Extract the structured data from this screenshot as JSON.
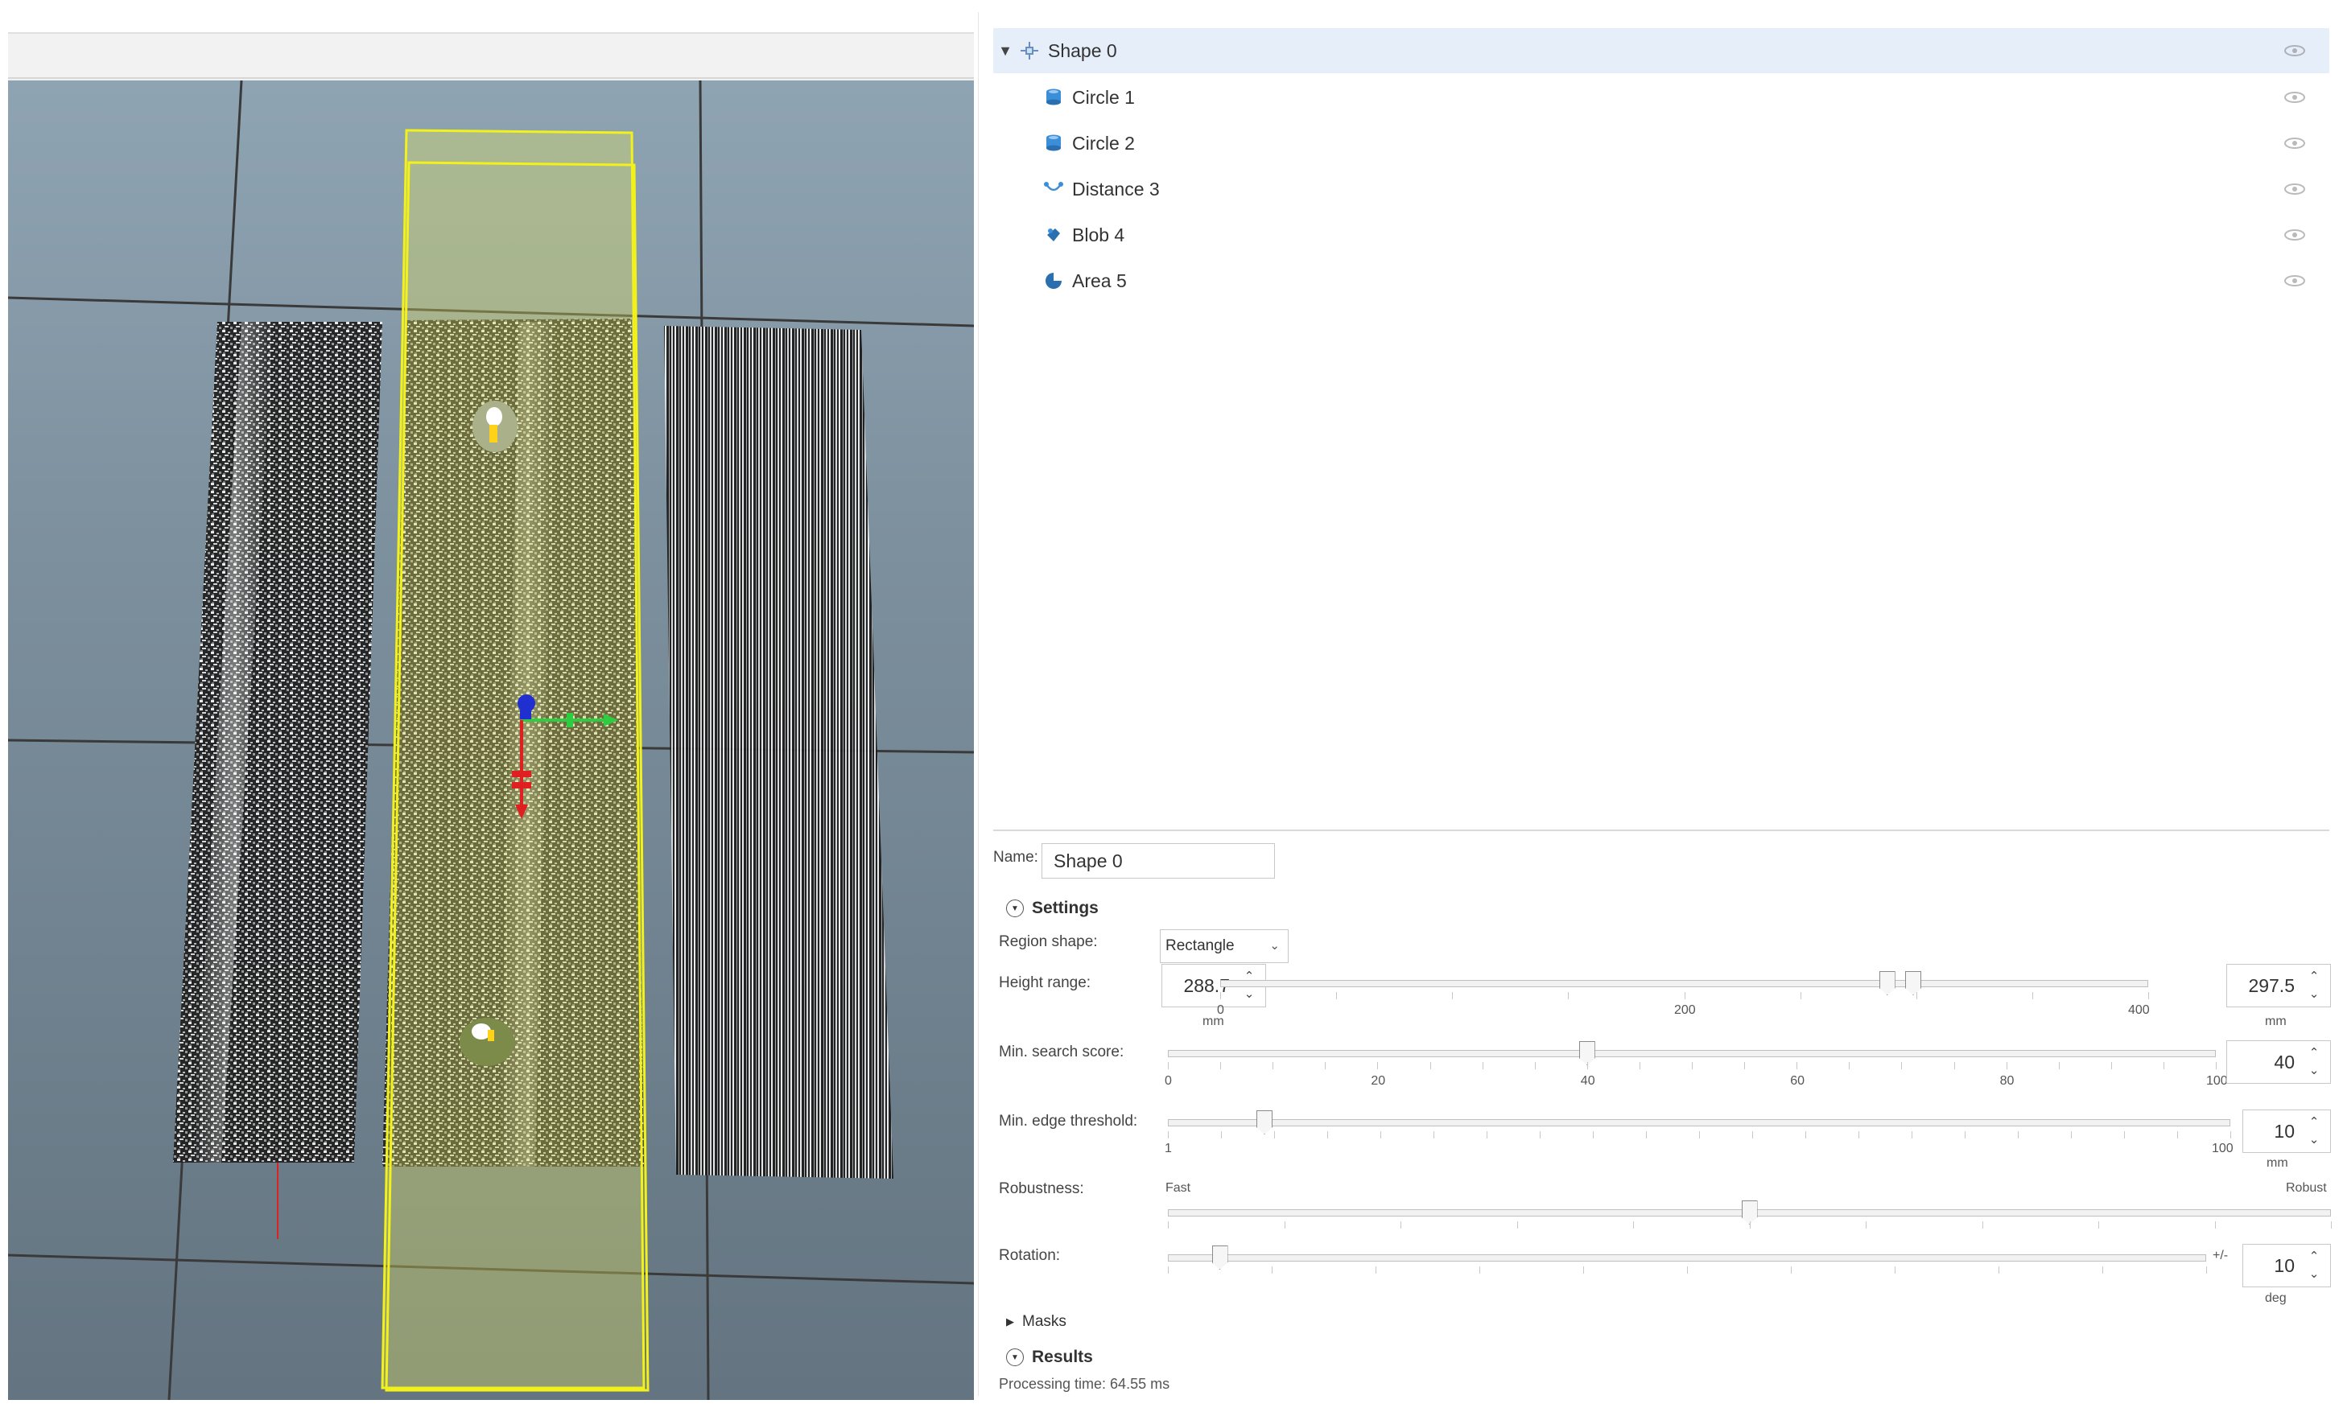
{
  "tree": {
    "items": [
      {
        "label": "Shape 0",
        "icon": "shape-move-icon",
        "selected": true,
        "expanded": true
      },
      {
        "label": "Circle 1",
        "icon": "cylinder-icon"
      },
      {
        "label": "Circle 2",
        "icon": "cylinder-icon"
      },
      {
        "label": "Distance 3",
        "icon": "distance-icon"
      },
      {
        "label": "Blob 4",
        "icon": "blob-icon"
      },
      {
        "label": "Area 5",
        "icon": "area-icon"
      }
    ]
  },
  "properties": {
    "name_label": "Name:",
    "name_value": "Shape 0",
    "settings_label": "Settings",
    "region_shape": {
      "label": "Region shape:",
      "value": "Rectangle"
    },
    "height_range": {
      "label": "Height range:",
      "min_value": "288.7",
      "max_value": "297.5",
      "min_unit": "mm",
      "max_unit": "mm",
      "scale_min": "0",
      "scale_mid": "200",
      "scale_max": "400",
      "range_start": 288.7,
      "range_end": 297.5,
      "range_limits": [
        0,
        400
      ]
    },
    "min_search_score": {
      "label": "Min. search score:",
      "value": "40",
      "ticks": [
        "0",
        "20",
        "40",
        "60",
        "80",
        "100"
      ],
      "level": 40,
      "limits": [
        0,
        100
      ]
    },
    "min_edge_threshold": {
      "label": "Min. edge threshold:",
      "value": "10",
      "unit": "mm",
      "scale_min": "1",
      "scale_max": "100",
      "level": 10,
      "limits": [
        1,
        100
      ]
    },
    "robustness": {
      "label": "Robustness:",
      "low_label": "Fast",
      "high_label": "Robust",
      "level": 0.5
    },
    "rotation": {
      "label": "Rotation:",
      "plus_minus": "+/-",
      "value": "10",
      "unit": "deg",
      "level": 0.05
    },
    "masks_label": "Masks",
    "results_label": "Results",
    "processing_time": "Processing time: 64.55 ms"
  },
  "colors": {
    "selection": "#e5eef9",
    "region_box": "#f2f21a",
    "axis_x": "#2ecc40",
    "axis_y": "#e02020",
    "axis_z": "#2030d0",
    "background": "#7d909e"
  }
}
